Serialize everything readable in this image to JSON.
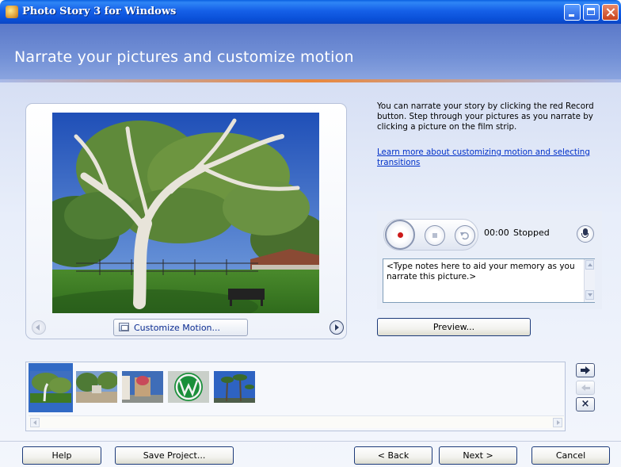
{
  "window": {
    "title": "Photo Story 3 for Windows"
  },
  "header": {
    "title": "Narrate your pictures and customize motion"
  },
  "preview": {
    "customize_label": "Customize Motion..."
  },
  "instructions": {
    "text": "You can narrate your story by clicking the red Record button. Step through your pictures as you narrate by clicking a picture on the film strip.",
    "link": "Learn more about customizing motion and selecting transitions"
  },
  "narration": {
    "timer": "00:00",
    "status": "Stopped",
    "notes_placeholder": "<Type notes here to aid your memory as you narrate this picture.>",
    "record_color": "#cc1a1a"
  },
  "buttons": {
    "preview": "Preview...",
    "help": "Help",
    "save_project": "Save Project...",
    "back": "< Back",
    "next": "Next >",
    "cancel": "Cancel"
  },
  "filmstrip": {
    "thumbnails": [
      "tree-park",
      "fountain-plaza",
      "ornate-statue",
      "volkswagen-logo",
      "palm-trees"
    ],
    "selected_index": 0,
    "side_buttons": {
      "remove": "×"
    }
  },
  "colors": {
    "titlebar": "#0a50d8",
    "header": "#6e8cd4",
    "accent_orange": "#e9883d",
    "selection": "#316ac5"
  }
}
